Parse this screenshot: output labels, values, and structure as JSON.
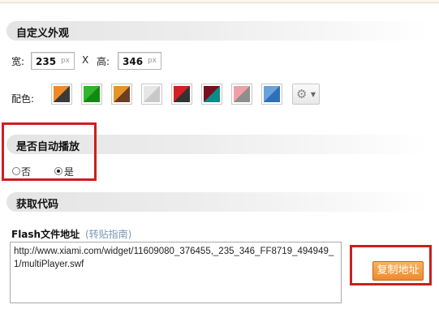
{
  "appearance": {
    "title": "自定义外观",
    "width_label": "宽:",
    "width_value": "235",
    "height_label": "高:",
    "height_value": "346",
    "unit": "px",
    "separator": "X",
    "color_label": "配色:",
    "swatches": [
      {
        "a": "#f08a24",
        "b": "#3a3a3a"
      },
      {
        "a": "#2fb52f",
        "b": "#128a12"
      },
      {
        "a": "#e3952c",
        "b": "#6b3f1f"
      },
      {
        "a": "#e6e6e6",
        "b": "#c8c8c8"
      },
      {
        "a": "#d81d23",
        "b": "#333333"
      },
      {
        "a": "#7a0e1e",
        "b": "#0a8a88"
      },
      {
        "a": "#f0a0a5",
        "b": "#8e8e8e"
      },
      {
        "a": "#6aa3d9",
        "b": "#2f6fb8"
      }
    ],
    "more_icon": "gear-icon"
  },
  "autoplay": {
    "title": "是否自动播放",
    "options": [
      {
        "label": "否",
        "checked": false
      },
      {
        "label": "是",
        "checked": true
      }
    ]
  },
  "code": {
    "title": "获取代码",
    "flash_label": "Flash文件地址",
    "guide_link": "(转贴指南)",
    "flash_url": "http://www.xiami.com/widget/11609080_376455,_235_346_FF8719_494949_1/multiPlayer.swf",
    "copy_label": "复制地址"
  },
  "colors": {
    "highlight_frame": "#cc1f1f",
    "copy_button": "#ef8a2c",
    "link": "#7a98b8"
  }
}
